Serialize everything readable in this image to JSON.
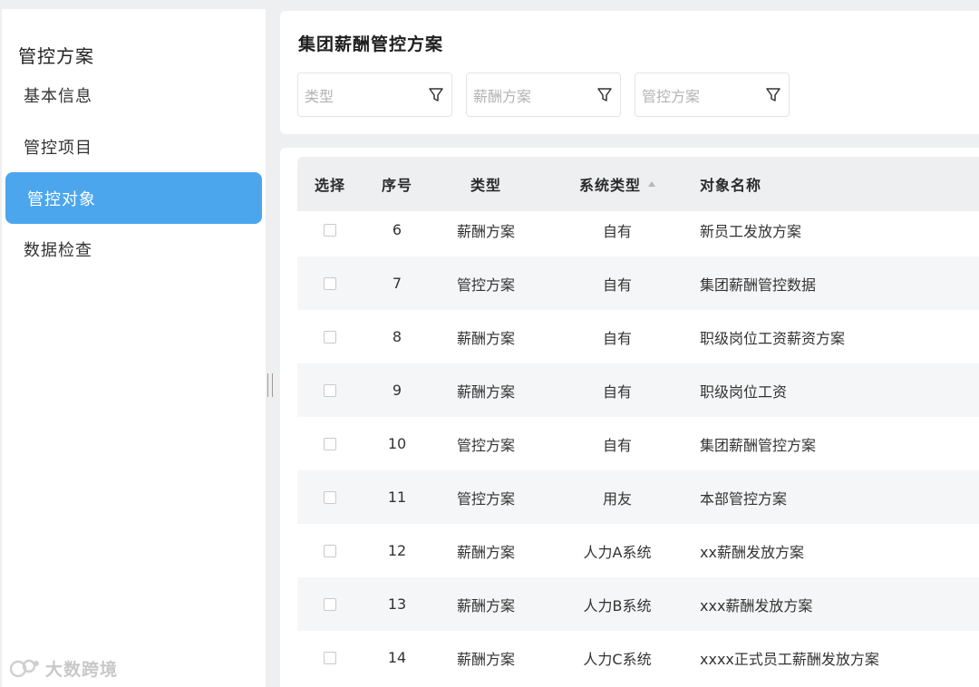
{
  "sidebar": {
    "title": "管控方案",
    "items": [
      {
        "label": "基本信息"
      },
      {
        "label": "管控项目"
      },
      {
        "label": "管控对象"
      },
      {
        "label": "数据检查"
      }
    ]
  },
  "main": {
    "title": "集团薪酬管控方案",
    "filters": [
      {
        "placeholder": "类型"
      },
      {
        "placeholder": "薪酬方案"
      },
      {
        "placeholder": "管控方案"
      }
    ]
  },
  "table": {
    "headers": {
      "select": "选择",
      "no": "序号",
      "type": "类型",
      "system_type": "系统类型",
      "name": "对象名称"
    },
    "rows": [
      {
        "no": "6",
        "type": "薪酬方案",
        "system_type": "自有",
        "name": "新员工发放方案"
      },
      {
        "no": "7",
        "type": "管控方案",
        "system_type": "自有",
        "name": "集团薪酬管控数据"
      },
      {
        "no": "8",
        "type": "薪酬方案",
        "system_type": "自有",
        "name": "职级岗位工资薪资方案"
      },
      {
        "no": "9",
        "type": "薪酬方案",
        "system_type": "自有",
        "name": "职级岗位工资"
      },
      {
        "no": "10",
        "type": "管控方案",
        "system_type": "自有",
        "name": "集团薪酬管控方案"
      },
      {
        "no": "11",
        "type": "管控方案",
        "system_type": "用友",
        "name": "本部管控方案"
      },
      {
        "no": "12",
        "type": "薪酬方案",
        "system_type": "人力A系统",
        "name": "xx薪酬发放方案"
      },
      {
        "no": "13",
        "type": "薪酬方案",
        "system_type": "人力B系统",
        "name": "xxx薪酬发放方案"
      },
      {
        "no": "14",
        "type": "薪酬方案",
        "system_type": "人力C系统",
        "name": "xxxx正式员工薪酬发放方案"
      }
    ]
  },
  "watermark": {
    "text": "大数跨境"
  },
  "colors": {
    "accent": "#4ba6ee",
    "page_bg": "#eeeff1",
    "alt_row": "#f5f6f7"
  }
}
